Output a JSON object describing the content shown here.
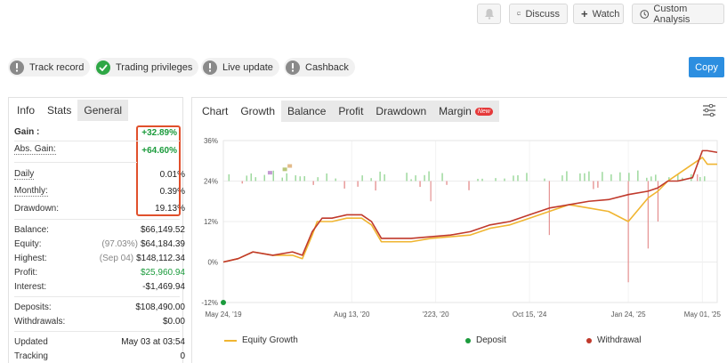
{
  "header": {
    "discuss_label": "Discuss",
    "watch_label": "Watch",
    "custom_analysis_label": "Custom Analysis"
  },
  "badges": [
    {
      "label": "Track record",
      "status": "gray"
    },
    {
      "label": "Trading privileges",
      "status": "green"
    },
    {
      "label": "Live update",
      "status": "gray"
    },
    {
      "label": "Cashback",
      "status": "gray"
    }
  ],
  "copy_label": "Copy",
  "info_panel": {
    "tabs": [
      "Info",
      "Stats",
      "General"
    ],
    "gain": {
      "label": "Gain :",
      "value": "+32.89%"
    },
    "abs_gain": {
      "label": "Abs. Gain:",
      "value": "+64.60%"
    },
    "daily": {
      "label": "Daily",
      "value": "0.01%"
    },
    "monthly": {
      "label": "Monthly:",
      "value": "0.39%"
    },
    "drawdown": {
      "label": "Drawdown:",
      "value": "19.13%"
    },
    "balance": {
      "label": "Balance:",
      "value": "$66,149.52"
    },
    "equity": {
      "label": "Equity:",
      "prefix": "(97.03%)",
      "value": "$64,184.39"
    },
    "highest": {
      "label": "Highest:",
      "prefix": "(Sep 04)",
      "value": "$148,112.34"
    },
    "profit": {
      "label": "Profit:",
      "value": "$25,960.94"
    },
    "interest": {
      "label": "Interest:",
      "value": "-$1,469.94"
    },
    "deposits": {
      "label": "Deposits:",
      "value": "$108,490.00"
    },
    "withdrawals": {
      "label": "Withdrawals:",
      "value": "$0.00"
    },
    "updated": {
      "label": "Updated",
      "value": "May 03 at 03:54"
    },
    "tracking": {
      "label": "Tracking",
      "value": "0"
    }
  },
  "chart_panel": {
    "chart_label": "Chart",
    "tabs": [
      "Growth",
      "Balance",
      "Profit",
      "Drawdown",
      "Margin"
    ],
    "new_badge": "New",
    "legend": [
      {
        "label": "Equity Growth",
        "color": "#f0b531"
      },
      {
        "label": "Deposit",
        "color": "#1b9b3c"
      },
      {
        "label": "Withdrawal",
        "color": "#c0392b"
      }
    ]
  },
  "chart_data": {
    "type": "line",
    "y_ticks": [
      "36%",
      "24%",
      "12%",
      "0%",
      "-12%"
    ],
    "x_ticks": [
      "May 24, '19",
      "Aug 13, '20",
      "'223, '20",
      "Oct 15, '24",
      "Jan 24, '25",
      "May 01, '25"
    ],
    "ylim": [
      -12,
      36
    ],
    "series": [
      {
        "name": "Growth",
        "color": "#c0392b",
        "x": [
          0,
          3,
          6,
          10,
          14,
          16,
          18,
          19,
          20,
          22,
          25,
          28,
          30,
          32,
          35,
          38,
          42,
          46,
          50,
          54,
          58,
          62,
          66,
          70,
          74,
          78,
          82,
          86,
          88,
          90,
          92,
          95,
          97,
          98,
          100
        ],
        "values": [
          0,
          1,
          3,
          2,
          3,
          2,
          9,
          11,
          13,
          13,
          14,
          14,
          12,
          7,
          7,
          7,
          7.5,
          8,
          9,
          11,
          12,
          14,
          16,
          17,
          18,
          18.5,
          20,
          21,
          22,
          24,
          24,
          25,
          33,
          33,
          32.5
        ]
      },
      {
        "name": "Equity Growth",
        "color": "#f0b531",
        "x": [
          0,
          3,
          6,
          10,
          14,
          16,
          18,
          19,
          20,
          22,
          25,
          28,
          30,
          32,
          35,
          38,
          42,
          46,
          50,
          54,
          58,
          62,
          66,
          70,
          74,
          78,
          82,
          86,
          88,
          90,
          92,
          95,
          97,
          98,
          100
        ],
        "values": [
          0,
          1,
          3,
          2,
          2,
          1,
          8,
          12,
          12,
          12,
          13,
          13,
          11,
          6,
          6,
          6,
          7,
          7.5,
          8,
          10,
          11,
          13,
          15,
          17,
          16,
          15,
          12,
          19,
          21,
          24,
          26,
          29,
          31,
          29,
          29
        ]
      }
    ],
    "legend_position": "bottom"
  }
}
